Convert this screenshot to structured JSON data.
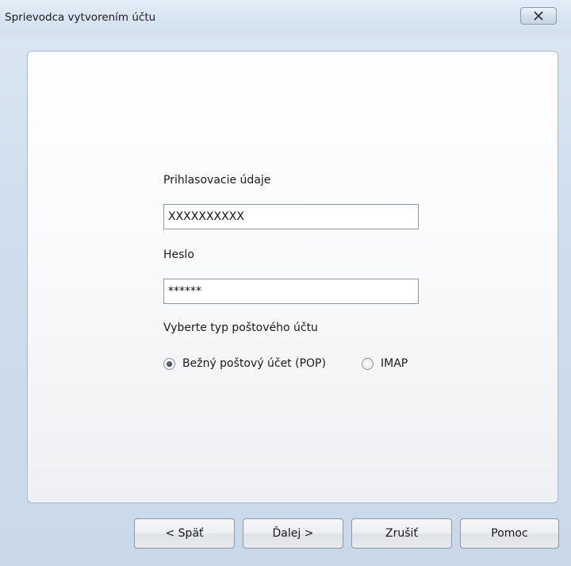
{
  "window": {
    "title": "Sprievodca vytvorením účtu",
    "close_label": "X"
  },
  "form": {
    "login_label": "Prihlasovacie údaje",
    "login_value": "XXXXXXXXXX",
    "password_label": "Heslo",
    "password_value": "******",
    "account_type_label": "Vyberte typ poštového účtu",
    "options": [
      {
        "label": "Bežný poštový účet (POP)",
        "selected": true
      },
      {
        "label": "IMAP",
        "selected": false
      }
    ]
  },
  "buttons": {
    "back": "< Späť",
    "next": "Ďalej >",
    "cancel": "Zrušiť",
    "help": "Pomoc"
  }
}
